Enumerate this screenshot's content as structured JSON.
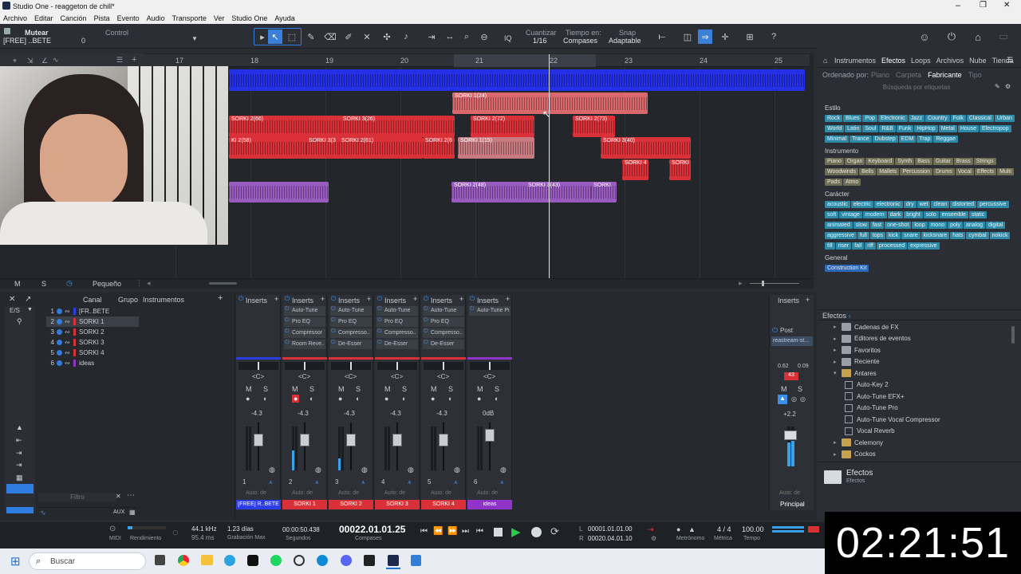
{
  "window": {
    "title": "Studio One - reaggeton de chill*"
  },
  "menu": [
    "Archivo",
    "Editar",
    "Canción",
    "Pista",
    "Evento",
    "Audio",
    "Transporte",
    "Ver",
    "Studio One",
    "Ayuda"
  ],
  "toolbar": {
    "mute_label": "Mutear",
    "track_name": "[FREE] ..BETE",
    "mute_value": "0",
    "control_label": "Control",
    "quantize_label": "Cuantizar",
    "quantize_value": "1/16",
    "timebase_label": "Tiempo en:",
    "timebase_value": "Compases",
    "snap_label": "Snap",
    "snap_value": "Adaptable",
    "iq_label": "IQ",
    "help": "?"
  },
  "ruler": {
    "bars": [
      "17",
      "18",
      "19",
      "20",
      "21",
      "22",
      "23",
      "24",
      "25"
    ]
  },
  "clips": [
    {
      "label": "SORKI 1(24)"
    },
    {
      "label": "SORKI 2(66)"
    },
    {
      "label": "SORKI 3(26)"
    },
    {
      "label": "SORKI 2(72)"
    },
    {
      "label": "SORKI 2(73)"
    },
    {
      "label": "KI 2(58)"
    },
    {
      "label": "SORKI 3(3"
    },
    {
      "label": "SORKI 2(61)"
    },
    {
      "label": "SORKI 2(6"
    },
    {
      "label": "SORKI 1(15)"
    },
    {
      "label": "SORKI 3(40)"
    },
    {
      "label": "SORKI 4"
    },
    {
      "label": "SORKI"
    },
    {
      "label": "SORKI 2(48)"
    },
    {
      "label": "SORKI 3(43)"
    },
    {
      "label": "SORKI"
    }
  ],
  "arrange_footer": {
    "m": "M",
    "s": "S",
    "size": "Pequeño"
  },
  "browser": {
    "tabs": [
      "Instrumentos",
      "Efectos",
      "Loops",
      "Archivos",
      "Nube",
      "Tienda"
    ],
    "sort_label": "Ordenado por:",
    "sort_options": [
      "Plano",
      "Carpeta",
      "Fabricante",
      "Tipo"
    ],
    "search_placeholder": "Búsqueda por etiquetas",
    "style_label": "Estilo",
    "style_tags": [
      "Rock",
      "Blues",
      "Pop",
      "Electronic",
      "Jazz",
      "Country",
      "Folk",
      "Classical",
      "Urban",
      "World",
      "Latin",
      "Soul",
      "R&B",
      "Funk",
      "HipHop",
      "Metal",
      "House",
      "Electropop",
      "Minimal",
      "Trance",
      "Dubstep",
      "EDM",
      "Trap",
      "Reggae"
    ],
    "instrument_label": "Instrumento",
    "instrument_tags": [
      "Piano",
      "Organ",
      "Keyboard",
      "Synth",
      "Bass",
      "Guitar",
      "Brass",
      "Strings",
      "Woodwinds",
      "Bells",
      "Mallets",
      "Percussion",
      "Drums",
      "Vocal",
      "Effects",
      "Multi",
      "Pads",
      "Atmo"
    ],
    "character_label": "Carácter",
    "character_tags": [
      "acoustic",
      "electric",
      "electronic",
      "dry",
      "wet",
      "clean",
      "distorted",
      "percussive",
      "soft",
      "vintage",
      "modern",
      "dark",
      "bright",
      "solo",
      "ensemble",
      "static",
      "animated",
      "slow",
      "fast",
      "one-shot",
      "loop",
      "mono",
      "poly",
      "analog",
      "digital",
      "aggressive",
      "full",
      "tops",
      "kick",
      "snare",
      "kicksnare",
      "hats",
      "cymbal",
      "nokick",
      "fill",
      "riser",
      "fall",
      "riff",
      "processed",
      "expressive"
    ],
    "general_label": "General",
    "general_tags": [
      "Construction Kit"
    ],
    "path_label": "Efectos",
    "tree": [
      {
        "label": "Cadenas de FX",
        "level": 1
      },
      {
        "label": "Editores de eventos",
        "level": 1
      },
      {
        "label": "Favoritos",
        "level": 1
      },
      {
        "label": "Reciente",
        "level": 1
      },
      {
        "label": "Antares",
        "level": 1
      },
      {
        "label": "Auto-Key 2",
        "level": 2
      },
      {
        "label": "Auto-Tune EFX+",
        "level": 2
      },
      {
        "label": "Auto-Tune Pro",
        "level": 2
      },
      {
        "label": "Auto-Tune Vocal Compressor",
        "level": 2
      },
      {
        "label": "Vocal Reverb",
        "level": 2
      },
      {
        "label": "Celemony",
        "level": 1
      },
      {
        "label": "Cockos",
        "level": 1
      }
    ],
    "footer_title": "Efectos",
    "footer_sub": "Efectos"
  },
  "tracklist": {
    "headers": {
      "canal": "Canal",
      "grupo": "Grupo",
      "instrumentos": "Instrumentos"
    },
    "es": "E/S",
    "tracks": [
      {
        "num": "1",
        "name": "[FR..BETE"
      },
      {
        "num": "2",
        "name": "SORKI 1"
      },
      {
        "num": "3",
        "name": "SORKI 2"
      },
      {
        "num": "4",
        "name": "SORKI 3"
      },
      {
        "num": "5",
        "name": "SORKI 4"
      },
      {
        "num": "6",
        "name": "ideas"
      }
    ],
    "filter_placeholder": "Filtro"
  },
  "mixer": {
    "inserts_label": "Inserts",
    "channels": [
      {
        "name": "[FREE] R..BETE",
        "num": "1",
        "gain": "-4.3",
        "inserts": [],
        "color": "#2d3de6",
        "pan": "<C>",
        "auto": "Auto: de"
      },
      {
        "name": "SORKI 1",
        "num": "2",
        "gain": "-4.3",
        "inserts": [
          "Auto-Tune",
          "Pro EQ",
          "Compressor",
          "Room Reve..."
        ],
        "color": "#d93137",
        "pan": "<C>",
        "auto": "Auto: de"
      },
      {
        "name": "SORKI 2",
        "num": "3",
        "gain": "-4.3",
        "inserts": [
          "Auto-Tune",
          "Pro EQ",
          "Compresso...",
          "De-Esser"
        ],
        "color": "#d93137",
        "pan": "<C>",
        "auto": "Auto: de"
      },
      {
        "name": "SORKI 3",
        "num": "4",
        "gain": "-4.3",
        "inserts": [
          "Auto-Tune",
          "Pro EQ",
          "Compresso...",
          "De-Esser"
        ],
        "color": "#d93137",
        "pan": "<C>",
        "auto": "Auto: de"
      },
      {
        "name": "SORKI 4",
        "num": "5",
        "gain": "-4.3",
        "inserts": [
          "Auto-Tune",
          "Pro EQ",
          "Compresso...",
          "De-Esser"
        ],
        "color": "#d93137",
        "pan": "<C>",
        "auto": "Auto: de"
      },
      {
        "name": "ideas",
        "num": "6",
        "gain": "0dB",
        "inserts": [
          "Auto-Tune Pr..."
        ],
        "color": "#8f33c9",
        "pan": "<C>",
        "auto": "Auto: de"
      }
    ],
    "main": {
      "name": "Principal",
      "post": "Post",
      "insert": "reastream-st...",
      "peak_l": "0.62",
      "peak_r": "0.09",
      "clip": "43",
      "gain": "+2.2",
      "auto": "Auto: de"
    },
    "ms": {
      "m": "M",
      "s": "S"
    }
  },
  "transport": {
    "midi": "MIDI",
    "render_label": "Rendimiento",
    "sample_rate": "44.1 kHz",
    "latency": "95.4 ms",
    "record_max": "1.23 días",
    "record_max_label": "Grabación Max",
    "seconds": "00:00:50.438",
    "seconds_label": "Segundos",
    "position": "00022.01.01.25",
    "position_label": "Compases",
    "loop_start": "00001.01.01.00",
    "loop_end": "00020.04.01.10",
    "metronome_label": "Metrónomo",
    "signature": "4 / 4",
    "signature_label": "Métrica",
    "tempo": "100.00",
    "tempo_label": "Tempo"
  },
  "taskbar": {
    "search": "Buscar"
  },
  "overlay_timer": "02:21:51"
}
